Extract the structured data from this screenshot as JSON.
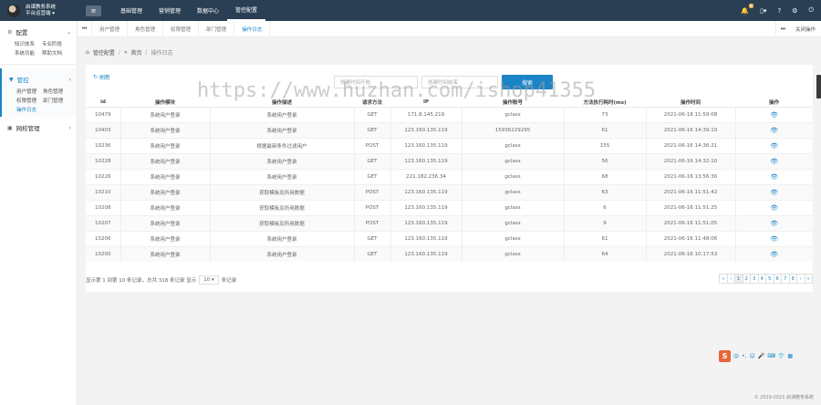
{
  "app": {
    "name_line1": "启课教务系统",
    "name_line2": "平台运营端 ▾"
  },
  "topnav": [
    "基础管理",
    "营销管理",
    "数据中心",
    "管控配置"
  ],
  "notifications": {
    "count": "8"
  },
  "sidebar": {
    "sections": [
      {
        "title": "配置",
        "items": [
          "知识体系",
          "专业阶段",
          "系统功能",
          "帮助文档"
        ]
      },
      {
        "title": "管控",
        "items": [
          "用户管理",
          "角色管理",
          "权限管理",
          "部门管理",
          "操作日志"
        ]
      },
      {
        "title": "网校管理",
        "items": []
      }
    ]
  },
  "tabs": [
    "用户管理",
    "角色管理",
    "权限管理",
    "部门管理",
    "操作日志"
  ],
  "tab_close_all": "关闭操作",
  "breadcrumb": [
    "管控配置",
    "首页",
    "操作日志"
  ],
  "toolbar": {
    "refresh_label": "刷新",
    "start_placeholder": "创建时间开始",
    "end_placeholder": "创建时间结束",
    "search_label": "搜索"
  },
  "table": {
    "headers": [
      "id",
      "操作模块",
      "操作描述",
      "请求方法",
      "IP",
      "操作账号",
      "方法执行耗时(ms)",
      "操作时间",
      "操作"
    ],
    "rows": [
      [
        "10479",
        "系统用户登录",
        "系统用户登录",
        "GET",
        "171.8.145.219",
        "gclass",
        "73",
        "2021-06-18 11:59:08"
      ],
      [
        "10403",
        "系统用户登录",
        "系统用户登录",
        "GET",
        "123.160.135.119",
        "15936229295",
        "61",
        "2021-06-16 14:39:19"
      ],
      [
        "10236",
        "系统用户登录",
        "根据最新条件过滤用户",
        "POST",
        "123.160.135.119",
        "gclass",
        "155",
        "2021-06-16 14:36:21"
      ],
      [
        "10228",
        "系统用户登录",
        "系统用户登录",
        "GET",
        "123.160.135.119",
        "gclass",
        "56",
        "2021-06-16 14:32:10"
      ],
      [
        "10226",
        "系统用户登录",
        "系统用户登录",
        "GET",
        "221.182.236.34",
        "gclass",
        "68",
        "2021-06-16 13:56:36"
      ],
      [
        "10210",
        "系统用户登录",
        "获取模板及所用数据",
        "POST",
        "123.160.135.119",
        "gclass",
        "63",
        "2021-06-16 11:51:42"
      ],
      [
        "10208",
        "系统用户登录",
        "获取模板及所用数据",
        "POST",
        "123.160.135.119",
        "gclass",
        "6",
        "2021-06-16 11:51:25"
      ],
      [
        "10207",
        "系统用户登录",
        "获取模板及所用数据",
        "POST",
        "123.160.135.119",
        "gclass",
        "9",
        "2021-06-16 11:51:05"
      ],
      [
        "10206",
        "系统用户登录",
        "系统用户登录",
        "GET",
        "123.160.135.119",
        "gclass",
        "61",
        "2021-06-16 11:48:06"
      ],
      [
        "10200",
        "系统用户登录",
        "系统用户登录",
        "GET",
        "123.160.135.119",
        "gclass",
        "64",
        "2021-06-16 10:17:53"
      ]
    ]
  },
  "pagination": {
    "info_prefix": "显示第 1 到第 10 条记录，总共 318 条记录 显示",
    "page_size": "10",
    "info_suffix": "条记录",
    "pages": [
      "«",
      "‹",
      "1",
      "2",
      "3",
      "4",
      "5",
      "6",
      "7",
      "8",
      "›",
      "»"
    ],
    "current": "1"
  },
  "watermark": "https://www.huzhan.com/ishop41355",
  "ime_bar": {
    "label": "中"
  },
  "footer": "© 2019-2021 启课教育系统",
  "colors": {
    "topbar": "#2a3f54",
    "accent": "#1c84c6",
    "ime": "#e8663a"
  }
}
